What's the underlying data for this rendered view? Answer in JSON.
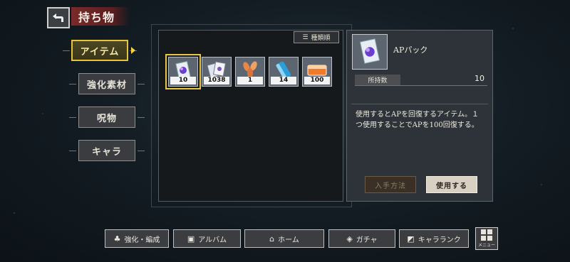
{
  "header": {
    "title": "持ち物",
    "back_icon": "back-arrow-icon"
  },
  "tabs": [
    {
      "label": "アイテム",
      "active": true
    },
    {
      "label": "強化素材",
      "active": false
    },
    {
      "label": "呪物",
      "active": false
    },
    {
      "label": "キャラ",
      "active": false
    }
  ],
  "sort": {
    "label": "種類順",
    "icon": "sort-icon"
  },
  "items": [
    {
      "name": "APパック",
      "count": "10",
      "icon": "ap-pack-icon",
      "selected": true
    },
    {
      "name": "",
      "count": "1038",
      "icon": "cards-icon",
      "selected": false
    },
    {
      "name": "",
      "count": "1",
      "icon": "leaves-icon",
      "selected": false
    },
    {
      "name": "",
      "count": "14",
      "icon": "drink-can-icon",
      "selected": false
    },
    {
      "name": "",
      "count": "100",
      "icon": "ticket-icon",
      "selected": false
    }
  ],
  "detail": {
    "name": "APパック",
    "owned_label": "所持数",
    "owned_value": "10",
    "description": "使用するとAPを回復するアイテム。１つ使用することでAPを100回復する。",
    "obtain_button": "入手方法",
    "use_button": "使用する"
  },
  "bottom_nav": [
    {
      "label": "強化・編成",
      "icon": "team-icon"
    },
    {
      "label": "アルバム",
      "icon": "album-icon"
    },
    {
      "label": "ホーム",
      "icon": "home-icon"
    },
    {
      "label": "ガチャ",
      "icon": "gacha-icon"
    },
    {
      "label": "キャラランク",
      "icon": "rank-icon"
    }
  ],
  "menu": {
    "label": "メニュー",
    "icon": "menu-grid-icon"
  },
  "colors": {
    "accent": "#e6c33f",
    "title_banner": "#6e2426",
    "panel": "#16191c"
  }
}
